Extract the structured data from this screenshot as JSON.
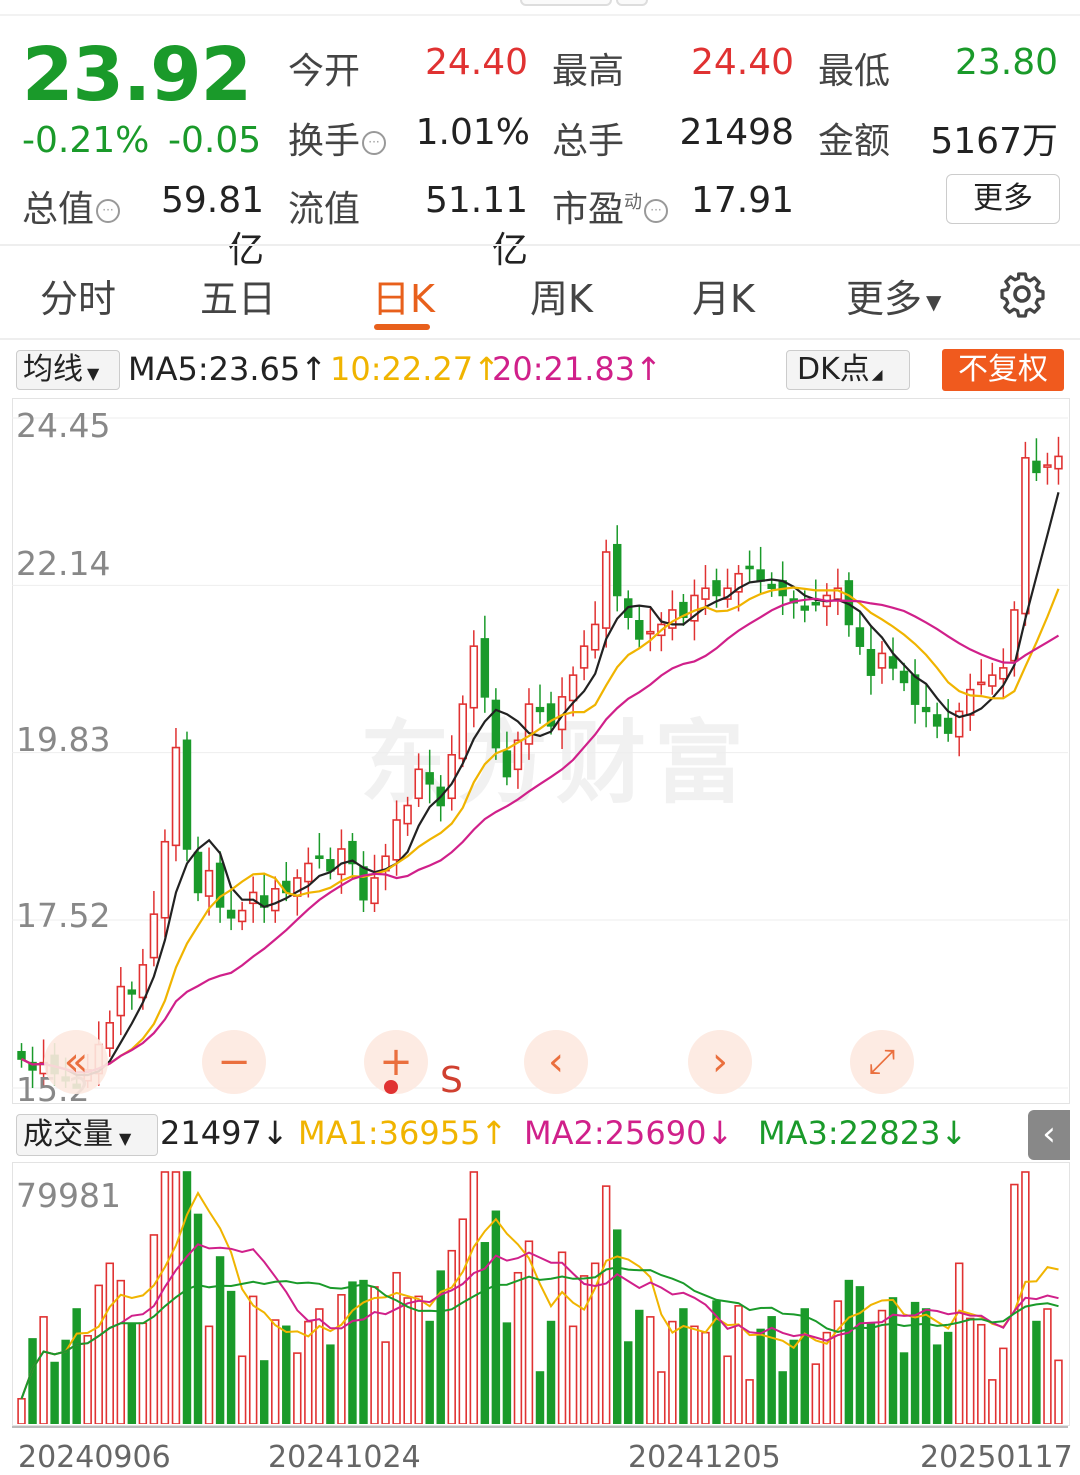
{
  "quote": {
    "price": "23.92",
    "change_pct": "-0.21%",
    "change": "-0.05",
    "open_label": "今开",
    "open": "24.40",
    "high_label": "最高",
    "high": "24.40",
    "low_label": "最低",
    "low": "23.80",
    "turnover_label": "换手",
    "turnover": "1.01%",
    "volume_label": "总手",
    "volume": "21498",
    "amount_label": "金额",
    "amount": "5167万",
    "mktcap_label": "总值",
    "mktcap": "59.81亿",
    "float_label": "流值",
    "float_cap": "51.11亿",
    "pe_label": "市盈",
    "pe_sup": "动",
    "pe": "17.91",
    "more_button": "更多",
    "info_icon": "ellipsis-circle-icon"
  },
  "period_tabs": {
    "items": [
      "分时",
      "五日",
      "日K",
      "周K",
      "月K",
      "更多"
    ],
    "active": "日K"
  },
  "ma_bar": {
    "selector": "均线",
    "ma5": "MA5:23.65",
    "ma10": "10:22.27",
    "ma20": "20:21.83",
    "arrow_up": "↑",
    "dk_button": "DK点",
    "adjust_button": "不复权"
  },
  "price_axis": [
    "24.45",
    "22.14",
    "19.83",
    "17.52",
    "15.2"
  ],
  "controls": [
    "−",
    "+",
    "‹",
    "›",
    "⤢"
  ],
  "control_icons": [
    "zoom-out-icon",
    "zoom-in-icon",
    "prev-icon",
    "next-icon",
    "expand-icon"
  ],
  "markers": {
    "sell": "S"
  },
  "volume_bar": {
    "selector": "成交量",
    "value": "21497",
    "arrow_down": "↓",
    "arrow_up": "↑",
    "ma1": "MA1:36955",
    "ma2": "MA2:25690",
    "ma3": "MA3:22823",
    "max_label": "79981",
    "collapse": "‹"
  },
  "x_axis": [
    "20240906",
    "20241024",
    "20241205",
    "20250117"
  ],
  "colors": {
    "up": "#e03232",
    "down": "#1a9a2a",
    "ma5": "#222222",
    "ma10": "#f0b400",
    "ma20": "#d0208a",
    "accent": "#e8601c"
  },
  "chart_data": {
    "type": "candlestick",
    "ylim": [
      15.2,
      24.45
    ],
    "volume_ylim": [
      0,
      79981
    ],
    "closes": [
      15.6,
      15.45,
      15.55,
      15.4,
      15.3,
      15.2,
      15.45,
      15.8,
      16.1,
      16.6,
      16.5,
      16.9,
      17.6,
      18.6,
      19.9,
      18.5,
      17.9,
      18.2,
      17.7,
      17.55,
      17.65,
      17.9,
      17.7,
      17.95,
      17.9,
      18.1,
      18.3,
      18.4,
      18.2,
      18.5,
      18.3,
      17.8,
      18.1,
      18.4,
      18.9,
      19.1,
      19.6,
      19.4,
      19.1,
      19.8,
      20.5,
      21.3,
      20.6,
      19.9,
      19.5,
      20.0,
      20.5,
      20.4,
      20.2,
      20.6,
      20.9,
      21.3,
      21.6,
      22.6,
      22.0,
      21.7,
      21.4,
      21.5,
      21.6,
      21.8,
      21.7,
      22.0,
      22.1,
      22.0,
      22.1,
      22.3,
      22.4,
      22.2,
      22.1,
      22.0,
      21.9,
      21.8,
      21.9,
      22.0,
      22.1,
      21.6,
      21.3,
      20.9,
      21.2,
      21.0,
      20.8,
      20.5,
      20.4,
      20.2,
      20.1,
      20.4,
      20.7,
      20.8,
      20.9,
      21.0,
      21.8,
      23.9,
      23.7,
      23.8,
      23.92
    ]
  }
}
